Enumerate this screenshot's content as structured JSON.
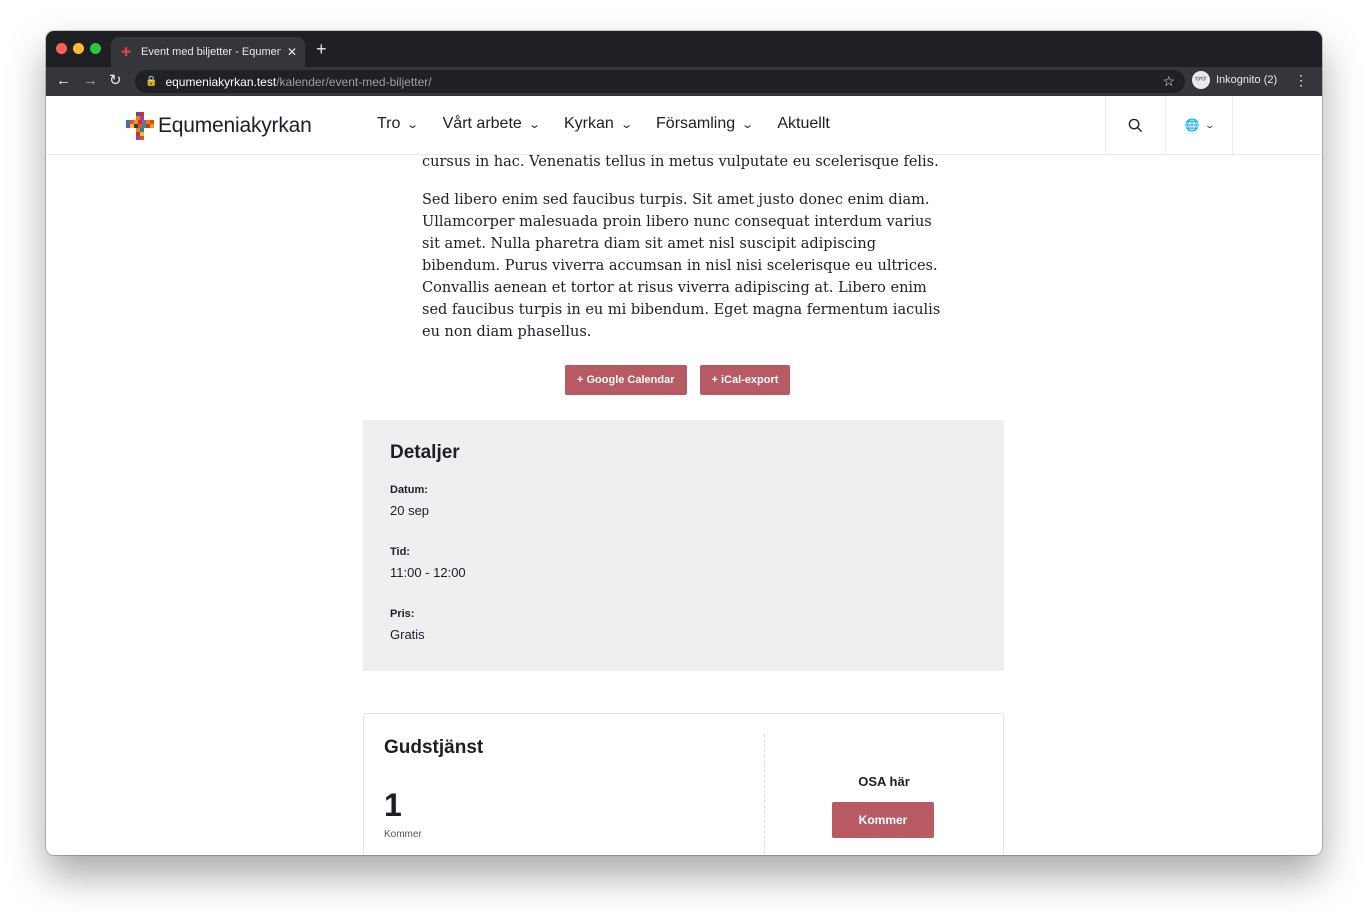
{
  "browser": {
    "tab_title": "Event med biljetter - Equmenia",
    "url_host": "equmeniakyrkan.test",
    "url_path": "/kalender/event-med-biljetter/",
    "incognito_label": "Inkognito (2)"
  },
  "site": {
    "logo_text": "Equmeniakyrkan",
    "nav": [
      {
        "label": "Tro",
        "has_dropdown": true
      },
      {
        "label": "Vårt arbete",
        "has_dropdown": true
      },
      {
        "label": "Kyrkan",
        "has_dropdown": true
      },
      {
        "label": "Församling",
        "has_dropdown": true
      },
      {
        "label": "Aktuellt",
        "has_dropdown": false
      }
    ],
    "brand_color": "#b85a63"
  },
  "article": {
    "partial_line": "cursus in hac. Venenatis tellus in metus vulputate eu scelerisque felis.",
    "paragraph": "Sed libero enim sed faucibus turpis. Sit amet justo donec enim diam. Ullamcorper malesuada proin libero nunc consequat interdum varius sit amet. Nulla pharetra diam sit amet nisl suscipit adipiscing bibendum. Purus viverra accumsan in nisl nisi scelerisque eu ultrices. Convallis aenean et tortor at risus viverra adipiscing at. Libero enim sed faucibus turpis in eu mi bibendum. Eget magna fermentum iaculis eu non diam phasellus."
  },
  "calendar_buttons": {
    "google": "+ Google Calendar",
    "ical": "+ iCal-export"
  },
  "details": {
    "title": "Detaljer",
    "date_label": "Datum:",
    "date_value": "20 sep",
    "time_label": "Tid:",
    "time_value": "11:00 - 12:00",
    "price_label": "Pris:",
    "price_value": "Gratis"
  },
  "ticket": {
    "name": "Gudstjänst",
    "count": "1",
    "count_label": "Kommer",
    "osa_label": "OSA här",
    "button_label": "Kommer"
  }
}
